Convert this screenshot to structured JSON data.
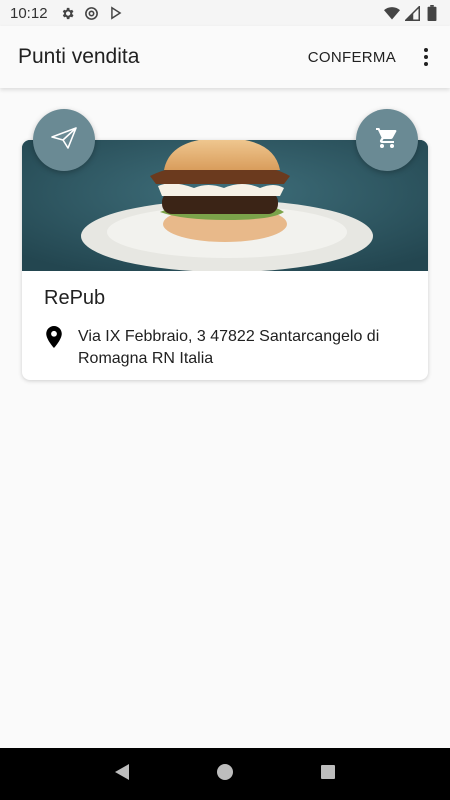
{
  "status_bar": {
    "time": "10:12",
    "icons": [
      "settings-icon",
      "at-sign-icon",
      "play-store-icon",
      "wifi-icon",
      "signal-icon",
      "battery-icon"
    ]
  },
  "app_bar": {
    "title": "Punti vendita",
    "confirm_label": "CONFERMA",
    "menu_icon": "more-vert-icon"
  },
  "store": {
    "name": "RePub",
    "address": "Via IX Febbraio, 3 47822 Santarcangelo di Romagna RN Italia",
    "image": "burger-photo",
    "location_icon": "location-pin-icon"
  },
  "fabs": {
    "send_icon": "paper-plane-icon",
    "cart_icon": "shopping-cart-icon",
    "color": "#6a8a94"
  },
  "nav_bar": {
    "back_icon": "back-triangle-icon",
    "home_icon": "home-circle-icon",
    "recents_icon": "recents-square-icon"
  }
}
